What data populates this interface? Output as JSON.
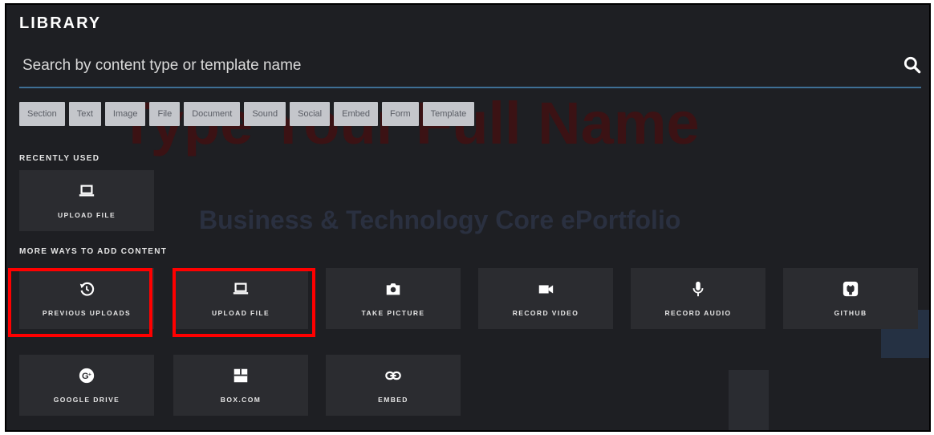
{
  "background": {
    "title": "Type Your Full Name",
    "subtitle": "Business & Technology Core ePortfolio"
  },
  "library": {
    "title": "LIBRARY",
    "search_placeholder": "Search by content type or template name",
    "filters": [
      "Section",
      "Text",
      "Image",
      "File",
      "Document",
      "Sound",
      "Social",
      "Embed",
      "Form",
      "Template"
    ],
    "recently_used_label": "RECENTLY USED",
    "recently_used": [
      {
        "label": "UPLOAD FILE",
        "icon": "laptop-icon"
      }
    ],
    "more_ways_label": "MORE WAYS TO ADD CONTENT",
    "more_ways": [
      {
        "label": "PREVIOUS UPLOADS",
        "icon": "history-icon"
      },
      {
        "label": "UPLOAD FILE",
        "icon": "laptop-icon"
      },
      {
        "label": "TAKE PICTURE",
        "icon": "camera-icon"
      },
      {
        "label": "RECORD VIDEO",
        "icon": "video-icon"
      },
      {
        "label": "RECORD AUDIO",
        "icon": "microphone-icon"
      },
      {
        "label": "GITHUB",
        "icon": "github-icon"
      },
      {
        "label": "GOOGLE DRIVE",
        "icon": "google-plus-icon"
      },
      {
        "label": "BOX.COM",
        "icon": "box-icon"
      },
      {
        "label": "EMBED",
        "icon": "link-icon"
      }
    ]
  },
  "colors": {
    "panel_bg": "#1e1f23",
    "tile_bg": "#2b2c30",
    "accent_underline": "#3e6f95",
    "highlight": "#ff0000"
  }
}
